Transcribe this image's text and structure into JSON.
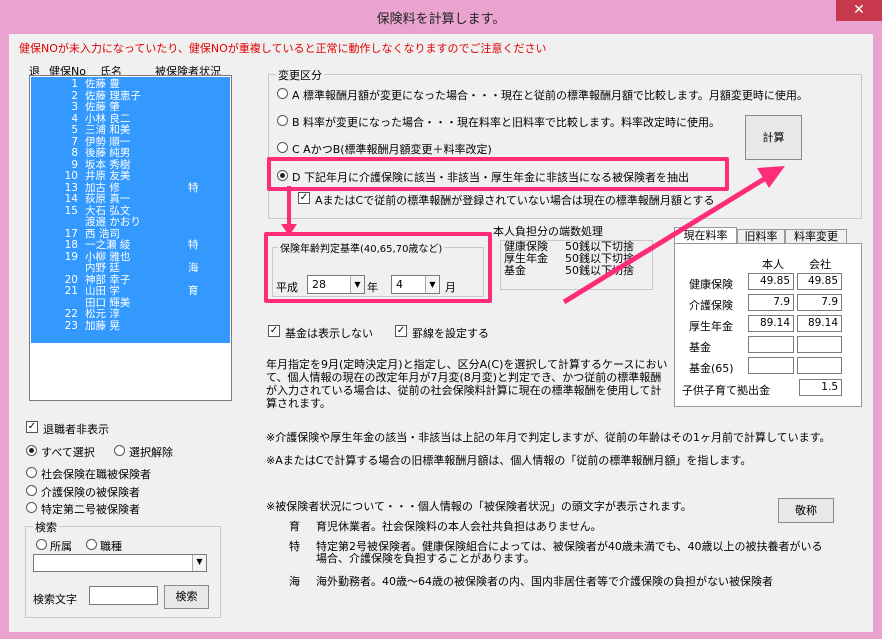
{
  "window": {
    "title": "保険料を計算します。",
    "close": "✕"
  },
  "warning": "健保NOが未入力になっていたり、健保NOが重複していると正常に動作しなくなりますのでご注意ください",
  "list": {
    "headers": [
      "退",
      "健保No",
      "氏名",
      "被保険者状況"
    ],
    "rows": [
      {
        "no": "1",
        "name": "佐藤 豊",
        "st": ""
      },
      {
        "no": "2",
        "name": "佐藤 理恵子",
        "st": ""
      },
      {
        "no": "3",
        "name": "佐藤 肇",
        "st": ""
      },
      {
        "no": "4",
        "name": "小林 良二",
        "st": ""
      },
      {
        "no": "5",
        "name": "三浦 和美",
        "st": ""
      },
      {
        "no": "7",
        "name": "伊勢 順一",
        "st": ""
      },
      {
        "no": "8",
        "name": "後藤 純男",
        "st": ""
      },
      {
        "no": "9",
        "name": "坂本 秀樹",
        "st": ""
      },
      {
        "no": "10",
        "name": "井原 友美",
        "st": ""
      },
      {
        "no": "13",
        "name": "加古 修",
        "st": "特"
      },
      {
        "no": "14",
        "name": "荻原 真一",
        "st": ""
      },
      {
        "no": "15",
        "name": "大石 弘文",
        "st": ""
      },
      {
        "no": "",
        "name": "渡邉 かおり",
        "st": ""
      },
      {
        "no": "17",
        "name": "西 浩司",
        "st": ""
      },
      {
        "no": "18",
        "name": "一之瀬 綾",
        "st": "特"
      },
      {
        "no": "19",
        "name": "小柳 雅也",
        "st": ""
      },
      {
        "no": "",
        "name": "内野 廷",
        "st": "海"
      },
      {
        "no": "20",
        "name": "神部 幸子",
        "st": ""
      },
      {
        "no": "21",
        "name": "山田 学",
        "st": "育"
      },
      {
        "no": "",
        "name": "田口 輝美",
        "st": ""
      },
      {
        "no": "22",
        "name": "松元 淳",
        "st": ""
      },
      {
        "no": "23",
        "name": "加藤 晃",
        "st": ""
      }
    ]
  },
  "left": {
    "retired_hide": "退職者非表示",
    "select_all": "すべて選択",
    "deselect": "選択解除",
    "opt1": "社会保険在職被保険者",
    "opt2": "介護保険の被保険者",
    "opt3": "特定第二号被保険者",
    "search_group": "検索",
    "dept": "所属",
    "job": "職種",
    "search_text": "検索文字",
    "search_btn": "検索"
  },
  "change": {
    "group": "変更区分",
    "a": "A 標準報酬月額が変更になった場合・・・現在と従前の標準報酬月額で比較します。月額変更時に使用。",
    "b": "B 料率が変更になった場合・・・現在料率と旧料率で比較します。料率改定時に使用。",
    "c": "C AかつB(標準報酬月額変更＋料率改定)",
    "d": "D 下記年月に介護保険に該当・非該当・厚生年金に非該当になる被保険者を抽出",
    "a_or_c": "AまたはCで従前の標準報酬が登録されていない場合は現在の標準報酬月額とする",
    "calc": "計算"
  },
  "age": {
    "group": "保険年齢判定基準(40,65,70歳など)",
    "era": "平成",
    "year": "28",
    "year_unit": "年",
    "month": "4",
    "month_unit": "月"
  },
  "rounding": {
    "title": "本人負担分の端数処理",
    "rows": [
      [
        "健康保険",
        "50銭以下切捨"
      ],
      [
        "厚生年金",
        "50銭以下切捨"
      ],
      [
        "基金",
        "50銭以下切捨"
      ]
    ]
  },
  "rates": {
    "tabs": [
      "現在料率",
      "旧料率",
      "料率変更"
    ],
    "col1": "本人",
    "col2": "会社",
    "rows": [
      {
        "label": "健康保険",
        "a": "49.85",
        "b": "49.85"
      },
      {
        "label": "介護保険",
        "a": "7.9",
        "b": "7.9"
      },
      {
        "label": "厚生年金",
        "a": "89.14",
        "b": "89.14"
      },
      {
        "label": "基金",
        "a": "",
        "b": ""
      },
      {
        "label": "基金(65)",
        "a": "",
        "b": ""
      }
    ],
    "child_label": "子供子育て拠出金",
    "child_value": "1.5"
  },
  "options": {
    "fund_hide": "基金は表示しない",
    "ruled": "罫線を設定する"
  },
  "notes": {
    "p1": [
      "年月指定を9月(定時決定月)と指定し、区分A(C)を選択して計算するケースにおい",
      "て、個人情報の現在の改定年月が7月変(8月変)と判定でき、かつ従前の標準報酬",
      "が入力されている場合は、従前の社会保険料計算に現在の標準報酬を使用して計",
      "算されます。"
    ],
    "n2": "※介護保険や厚生年金の該当・非該当は上記の年月で判定しますが、従前の年齢はその1ヶ月前で計算しています。",
    "n3": "※AまたはCで計算する場合の旧標準報酬月額は、個人情報の「従前の標準報酬月額」を指します。",
    "n4": "※被保険者状況について・・・個人情報の「被保険者状況」の頭文字が表示されます。",
    "honorific": "敬称",
    "legend": [
      {
        "k": "育",
        "v": [
          "育児休業者。社会保険料の本人会社共負担はありません。"
        ]
      },
      {
        "k": "特",
        "v": [
          "特定第2号被保険者。健康保険組合によっては、被保険者が40歳未満でも、40歳以上の被扶養者がいる",
          "場合、介護保険を負担することがあります。"
        ]
      },
      {
        "k": "海",
        "v": [
          "海外勤務者。40歳～64歳の被保険者の内、国内非居住者等で介護保険の負担がない被保険者"
        ]
      }
    ]
  },
  "colors": {
    "selection": "#3399ff",
    "highlight": "#ff2d79",
    "frame": "#e9a3ce",
    "warning": "#e00000"
  }
}
